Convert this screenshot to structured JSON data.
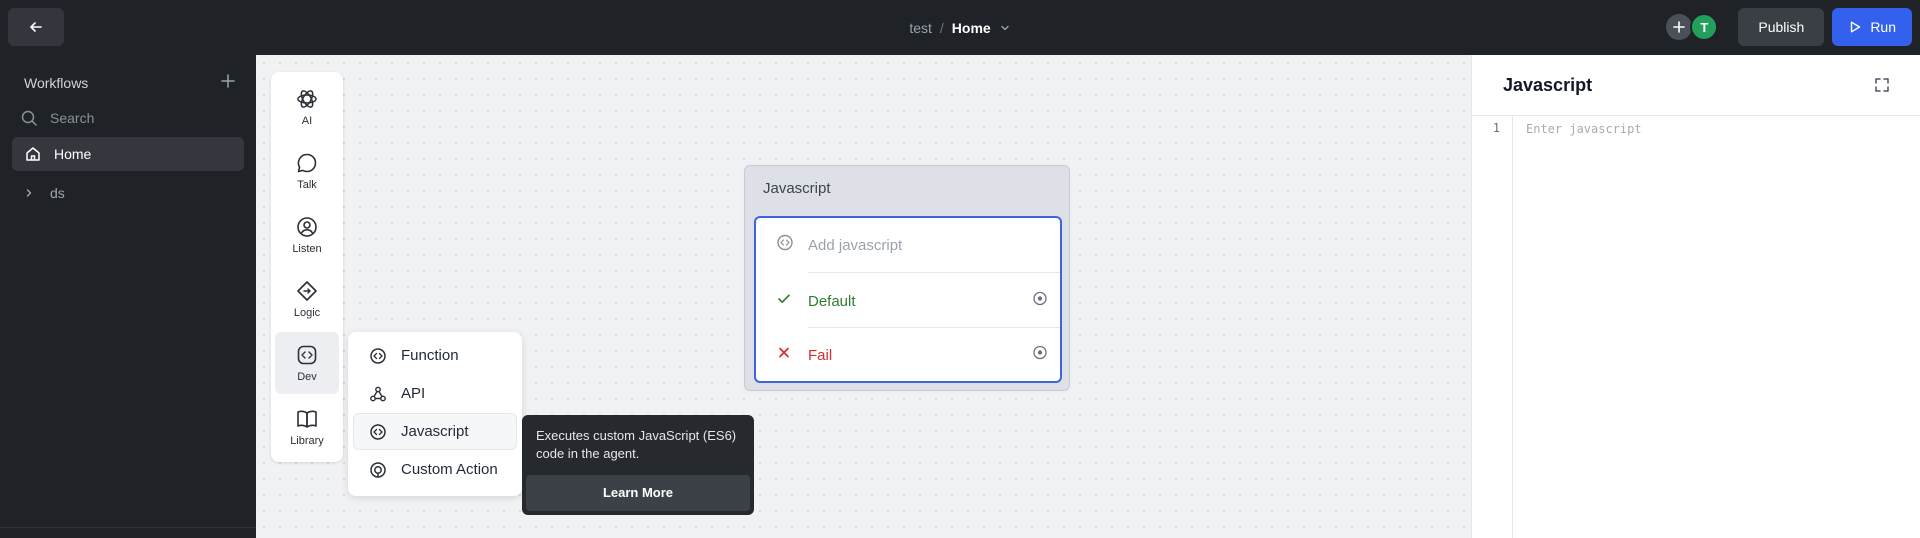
{
  "topbar": {
    "breadcrumb_project": "test",
    "breadcrumb_separator": "/",
    "breadcrumb_current": "Home",
    "avatar_initial": "T",
    "publish_label": "Publish",
    "run_label": "Run"
  },
  "sidebar": {
    "section_title": "Workflows",
    "search_placeholder": "Search",
    "items": [
      {
        "label": "Home",
        "icon": "home-icon",
        "selected": true
      },
      {
        "label": "ds",
        "icon": "chevron-right-icon",
        "selected": false
      }
    ]
  },
  "rail": {
    "items": [
      {
        "label": "AI",
        "icon": "openai-icon"
      },
      {
        "label": "Talk",
        "icon": "speech-bubble-icon"
      },
      {
        "label": "Listen",
        "icon": "user-circle-icon"
      },
      {
        "label": "Logic",
        "icon": "diamond-icon"
      },
      {
        "label": "Dev",
        "icon": "code-icon",
        "active": true
      },
      {
        "label": "Library",
        "icon": "book-icon"
      }
    ]
  },
  "dev_menu": {
    "items": [
      {
        "label": "Function",
        "icon": "code-circle-icon"
      },
      {
        "label": "API",
        "icon": "webhook-icon"
      },
      {
        "label": "Javascript",
        "icon": "code-circle-icon",
        "active": true
      },
      {
        "label": "Custom Action",
        "icon": "target-icon"
      }
    ]
  },
  "tooltip": {
    "text": "Executes custom JavaScript (ES6) code in the agent.",
    "button_label": "Learn More"
  },
  "node": {
    "title": "Javascript",
    "code_placeholder": "Add javascript",
    "paths": [
      {
        "label": "Default",
        "color": "#2e7d32",
        "icon": "check-icon"
      },
      {
        "label": "Fail",
        "color": "#d32f2f",
        "icon": "x-icon"
      }
    ]
  },
  "panel": {
    "title": "Javascript",
    "line_number": "1",
    "editor_placeholder": "Enter javascript"
  },
  "colors": {
    "accent": "#3361ee",
    "dark_bg": "#1f2226",
    "success": "#2e7d32",
    "danger": "#d32f2f"
  }
}
